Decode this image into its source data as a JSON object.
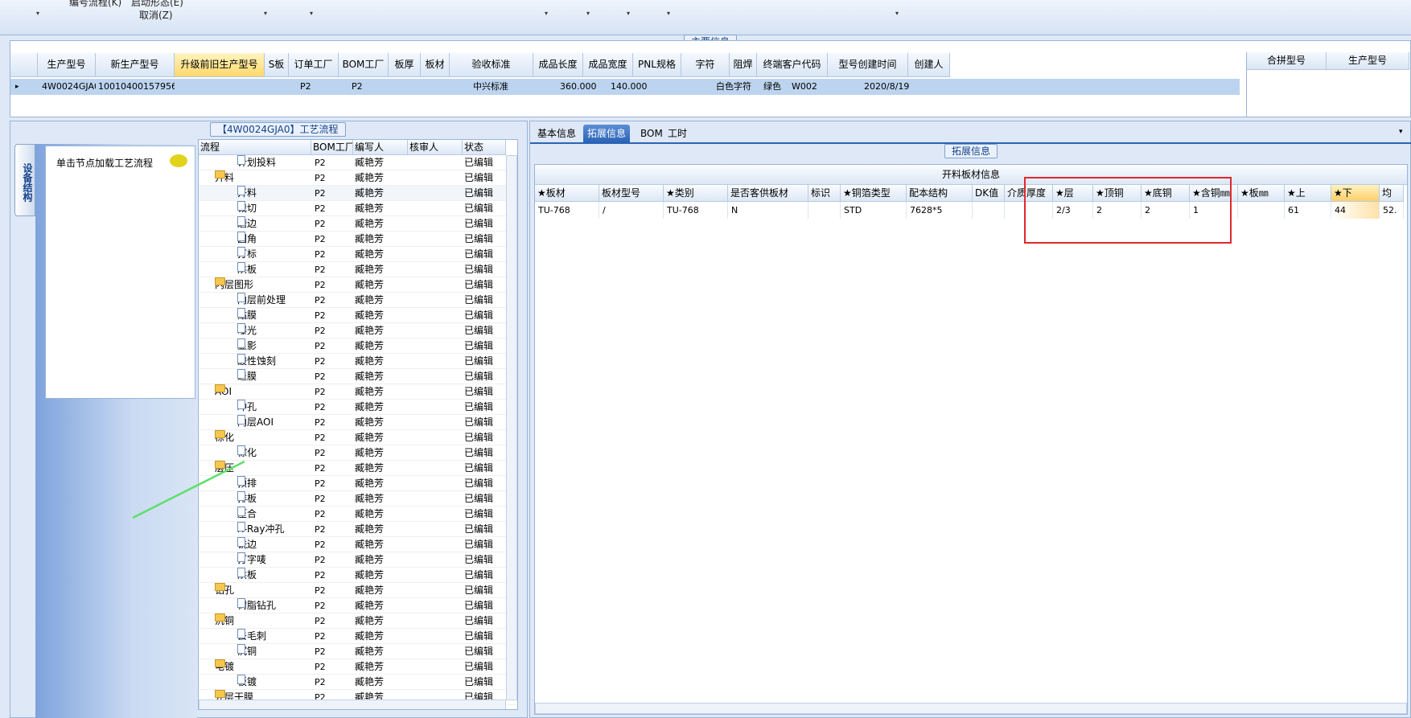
{
  "toolbar": {
    "item1": "编号流程(K)",
    "item2": "启动形态(E)",
    "cancel": "取消(Z)",
    "dropdown_glyph": "▾"
  },
  "main_info": {
    "title": "主要信息",
    "columns": [
      "生产型号",
      "新生产型号",
      "升级前旧生产型号",
      "S板",
      "订单工厂",
      "BOM工厂",
      "板厚",
      "板材",
      "验收标准",
      "成品长度",
      "成品宽度",
      "PNL规格",
      "字符",
      "阻焊",
      "终端客户代码",
      "型号创建时间",
      "创建人"
    ],
    "row": {
      "model": "4W0024GJA0",
      "new_model": "10010400157956",
      "order_factory": "P2",
      "bom_factory": "P2",
      "standard": "中兴标准",
      "length": "360.000",
      "width": "140.000",
      "character": "白色字符",
      "solder_mask": "绿色",
      "customer_code": "W002",
      "created": "2020/8/19"
    },
    "merge_columns": [
      "合拼型号",
      "生产型号"
    ]
  },
  "process": {
    "title": "【4W0024GJA0】工艺流程",
    "side_tab": "设备结构",
    "hint": "单击节点加载工艺流程",
    "columns": [
      "流程",
      "BOM工厂",
      "编写人",
      "核审人",
      "状态"
    ],
    "rows": [
      {
        "name": "计划投料",
        "level": 2,
        "type": "doc",
        "factory": "P2",
        "author": "臧艳芳",
        "status": "已编辑"
      },
      {
        "name": "开料",
        "level": 1,
        "type": "folder",
        "factory": "P2",
        "author": "臧艳芳",
        "status": "已编辑"
      },
      {
        "name": "开料",
        "level": 2,
        "type": "doc",
        "factory": "P2",
        "author": "臧艳芳",
        "status": "已编辑"
      },
      {
        "name": "裁切",
        "level": 2,
        "type": "doc",
        "factory": "P2",
        "author": "臧艳芳",
        "status": "已编辑"
      },
      {
        "name": "磨边",
        "level": 2,
        "type": "doc",
        "factory": "P2",
        "author": "臧艳芳",
        "status": "已编辑"
      },
      {
        "name": "圆角",
        "level": 2,
        "type": "doc",
        "factory": "P2",
        "author": "臧艳芳",
        "status": "已编辑"
      },
      {
        "name": "打标",
        "level": 2,
        "type": "doc",
        "factory": "P2",
        "author": "臧艳芳",
        "status": "已编辑"
      },
      {
        "name": "烘板",
        "level": 2,
        "type": "doc",
        "factory": "P2",
        "author": "臧艳芳",
        "status": "已编辑"
      },
      {
        "name": "内层图形",
        "level": 1,
        "type": "folder",
        "factory": "P2",
        "author": "臧艳芳",
        "status": "已编辑"
      },
      {
        "name": "内层前处理",
        "level": 2,
        "type": "doc",
        "factory": "P2",
        "author": "臧艳芳",
        "status": "已编辑"
      },
      {
        "name": "贴膜",
        "level": 2,
        "type": "doc",
        "factory": "P2",
        "author": "臧艳芳",
        "status": "已编辑"
      },
      {
        "name": "曝光",
        "level": 2,
        "type": "doc",
        "factory": "P2",
        "author": "臧艳芳",
        "status": "已编辑"
      },
      {
        "name": "显影",
        "level": 2,
        "type": "doc",
        "factory": "P2",
        "author": "臧艳芳",
        "status": "已编辑"
      },
      {
        "name": "酸性蚀刻",
        "level": 2,
        "type": "doc",
        "factory": "P2",
        "author": "臧艳芳",
        "status": "已编辑"
      },
      {
        "name": "退膜",
        "level": 2,
        "type": "doc",
        "factory": "P2",
        "author": "臧艳芳",
        "status": "已编辑"
      },
      {
        "name": "AOI",
        "level": 1,
        "type": "folder",
        "factory": "P2",
        "author": "臧艳芳",
        "status": "已编辑"
      },
      {
        "name": "冲孔",
        "level": 2,
        "type": "doc",
        "factory": "P2",
        "author": "臧艳芳",
        "status": "已编辑"
      },
      {
        "name": "内层AOI",
        "level": 2,
        "type": "doc",
        "factory": "P2",
        "author": "臧艳芳",
        "status": "已编辑"
      },
      {
        "name": "棕化",
        "level": 1,
        "type": "folder",
        "factory": "P2",
        "author": "臧艳芳",
        "status": "已编辑"
      },
      {
        "name": "棕化",
        "level": 2,
        "type": "doc",
        "factory": "P2",
        "author": "臧艳芳",
        "status": "已编辑"
      },
      {
        "name": "层压",
        "level": 1,
        "type": "folder",
        "factory": "P2",
        "author": "臧艳芳",
        "status": "已编辑"
      },
      {
        "name": "预排",
        "level": 2,
        "type": "doc",
        "factory": "P2",
        "author": "臧艳芳",
        "status": "已编辑"
      },
      {
        "name": "排板",
        "level": 2,
        "type": "doc",
        "factory": "P2",
        "author": "臧艳芳",
        "status": "已编辑"
      },
      {
        "name": "压合",
        "level": 2,
        "type": "doc",
        "factory": "P2",
        "author": "臧艳芳",
        "status": "已编辑"
      },
      {
        "name": "X-Ray冲孔",
        "level": 2,
        "type": "doc",
        "factory": "P2",
        "author": "臧艳芳",
        "status": "已编辑"
      },
      {
        "name": "铣边",
        "level": 2,
        "type": "doc",
        "factory": "P2",
        "author": "臧艳芳",
        "status": "已编辑"
      },
      {
        "name": "打字唛",
        "level": 2,
        "type": "doc",
        "factory": "P2",
        "author": "臧艳芳",
        "status": "已编辑"
      },
      {
        "name": "烘板",
        "level": 2,
        "type": "doc",
        "factory": "P2",
        "author": "臧艳芳",
        "status": "已编辑"
      },
      {
        "name": "钻孔",
        "level": 1,
        "type": "folder",
        "factory": "P2",
        "author": "臧艳芳",
        "status": "已编辑"
      },
      {
        "name": "树脂钻孔",
        "level": 2,
        "type": "doc",
        "factory": "P2",
        "author": "臧艳芳",
        "status": "已编辑"
      },
      {
        "name": "沉铜",
        "level": 1,
        "type": "folder",
        "factory": "P2",
        "author": "臧艳芳",
        "status": "已编辑"
      },
      {
        "name": "去毛刺",
        "level": 2,
        "type": "doc",
        "factory": "P2",
        "author": "臧艳芳",
        "status": "已编辑"
      },
      {
        "name": "沉铜",
        "level": 2,
        "type": "doc",
        "factory": "P2",
        "author": "臧艳芳",
        "status": "已编辑"
      },
      {
        "name": "电镀",
        "level": 1,
        "type": "folder",
        "factory": "P2",
        "author": "臧艳芳",
        "status": "已编辑"
      },
      {
        "name": "板镀",
        "level": 2,
        "type": "doc",
        "factory": "P2",
        "author": "臧艳芳",
        "status": "已编辑"
      },
      {
        "name": "外层干膜",
        "level": 1,
        "type": "folder",
        "factory": "P2",
        "author": "臧艳芳",
        "status": "已编辑"
      }
    ]
  },
  "right": {
    "tabs": [
      "基本信息",
      "拓展信息",
      "BOM",
      "工时"
    ],
    "active_tab": 1,
    "section_title": "拓展信息",
    "board_title": "开料板材信息",
    "board_columns": [
      "★板材",
      "板材型号",
      "★类别",
      "是否客供板材",
      "标识",
      "★铜箔类型",
      "配本结构",
      "DK值",
      "介质厚度",
      "★层",
      "★顶铜",
      "★底铜",
      "★含铜㎜",
      "★板㎜",
      "★上",
      "★下",
      "均"
    ],
    "board_row": [
      "TU-768",
      "/",
      "TU-768",
      "N",
      "",
      "STD",
      "7628*5",
      "",
      "",
      "2/3",
      "2",
      "2",
      "1",
      "",
      "61",
      "44",
      "52."
    ]
  },
  "colors": {
    "accent": "#2b63b6",
    "highlight": "#ffd86b",
    "annotation_box": "#e0282c",
    "annotation_line": "#5ee06a"
  }
}
